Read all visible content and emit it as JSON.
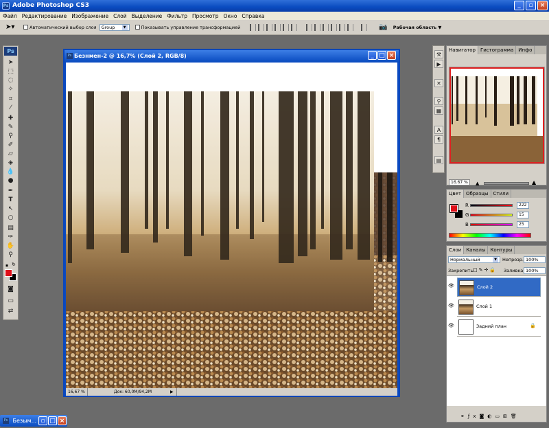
{
  "app": {
    "title": "Adobe Photoshop CS3",
    "icon": "ps-icon"
  },
  "menu": [
    "Файл",
    "Редактирование",
    "Изображение",
    "Слой",
    "Выделение",
    "Фильтр",
    "Просмотр",
    "Окно",
    "Справка"
  ],
  "options": {
    "auto_select_label": "Автоматический выбор слоя",
    "auto_select_value": "Group",
    "show_transform_label": "Показывать управление трансформацией",
    "workspace_label": "Рабочая область"
  },
  "document": {
    "title": "Безнмен-2 @ 16,7% (Слой 2, RGB/8)",
    "zoom": "16,67 %",
    "doc_info": "Док: 60,0M/94,2M"
  },
  "navigator": {
    "tabs": [
      "Навигатор",
      "Гистограмма",
      "Инфо"
    ],
    "zoom": "16.67 %"
  },
  "color": {
    "tabs": [
      "Цвет",
      "Образцы",
      "Стили"
    ],
    "r_label": "R",
    "g_label": "G",
    "b_label": "B",
    "r": "222",
    "g": "15",
    "b": "25",
    "foreground": "#de0f19",
    "background": "#000000"
  },
  "layers": {
    "tabs": [
      "Слои",
      "Каналы",
      "Контуры"
    ],
    "blend_mode": "Нормальный",
    "opacity_label": "Непрозр.:",
    "opacity": "100%",
    "lock_label": "Закрепить:",
    "fill_label": "Заливка:",
    "fill": "100%",
    "items": [
      {
        "name": "Слой 2"
      },
      {
        "name": "Слой 1"
      },
      {
        "name": "Задний план"
      }
    ]
  },
  "taskbar": {
    "label": "Безым..."
  }
}
